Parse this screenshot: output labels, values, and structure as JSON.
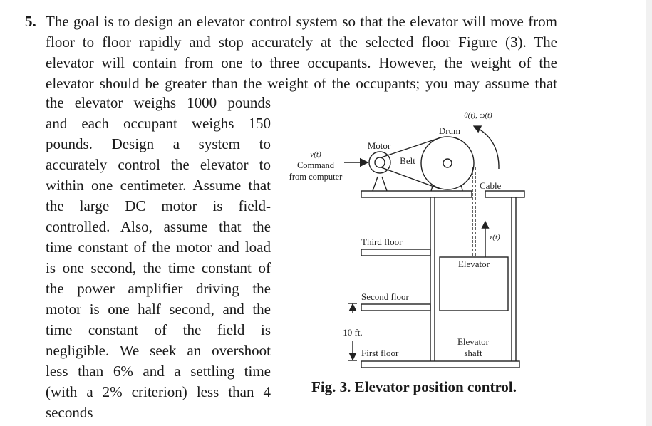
{
  "problem": {
    "number": "5.",
    "full_width_lines": [
      "The goal is to design an elevator control system so that the elevator will move from",
      "floor to floor rapidly and stop accurately at the selected floor Figure (3). The",
      "elevator will contain from one to three occupants. However, the weight of the",
      "elevator should be greater than the weight of the occupants; you may assume that"
    ],
    "column_lines": [
      "the elevator weighs 1000 pounds",
      "and each occupant weighs 150",
      "pounds. Design a system to",
      "accurately control the elevator to",
      "within one centimeter. Assume that",
      "the large DC motor is field-",
      "controlled. Also, assume that the",
      "time constant of the motor and load",
      "is one second, the time constant of",
      "the power amplifier driving the",
      "motor is one half second, and the",
      "time constant of the field is",
      "negligible. We seek an overshoot",
      "less than 6% and a settling time",
      "(with a 2% criterion) less than 4",
      "seconds"
    ]
  },
  "figure": {
    "caption": "Fig. 3. Elevator position control.",
    "labels": {
      "input_signal": "v(t)",
      "command": "Command",
      "from_computer": "from computer",
      "motor": "Motor",
      "belt": "Belt",
      "drum": "Drum",
      "drum_angle": "θ(t), ω(t)",
      "cable": "Cable",
      "position": "z(t)",
      "third_floor": "Third floor",
      "second_floor": "Second floor",
      "first_floor": "First floor",
      "floor_spacing": "10 ft.",
      "elevator": "Elevator",
      "shaft_line1": "Elevator",
      "shaft_line2": "shaft"
    }
  }
}
